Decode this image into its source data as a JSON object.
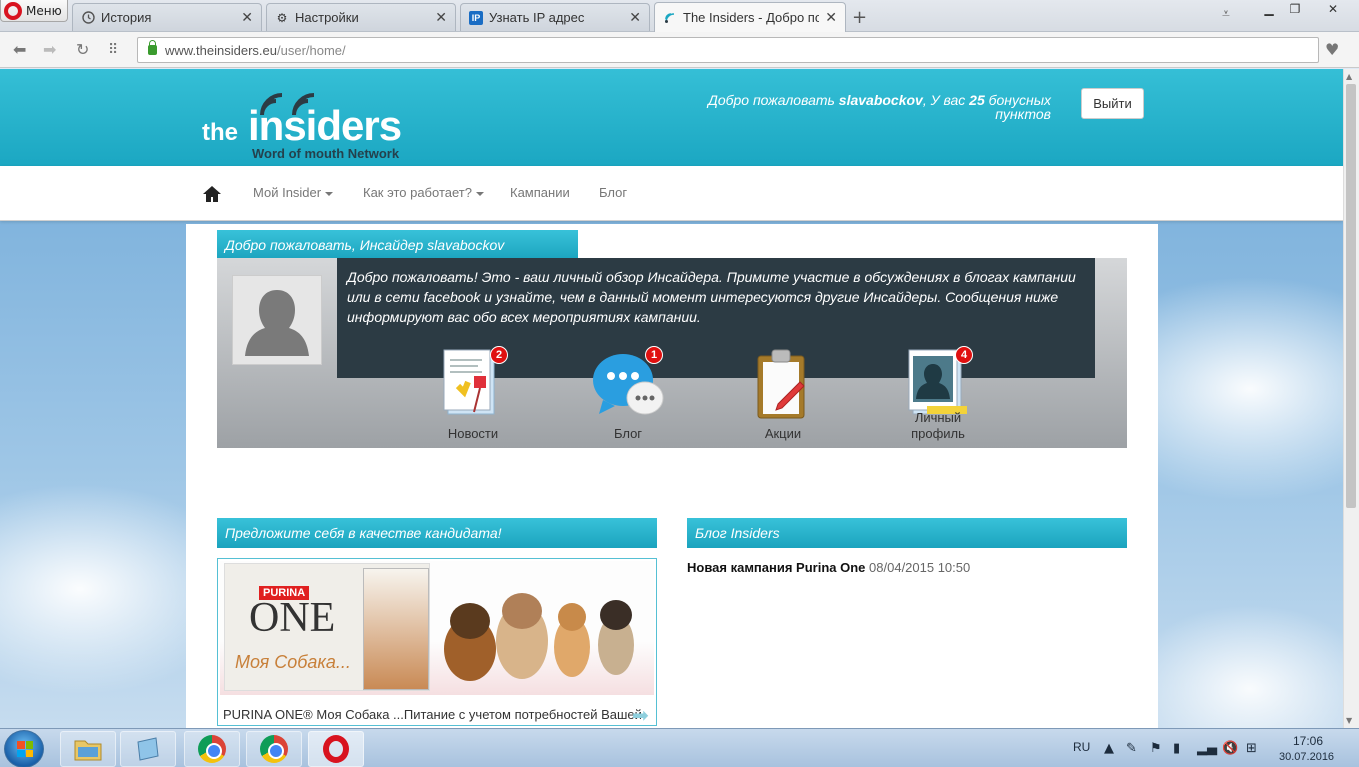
{
  "browser": {
    "menu_label": "Меню",
    "tabs": [
      {
        "label": "История",
        "icon": "clock-icon"
      },
      {
        "label": "Настройки",
        "icon": "gear-icon"
      },
      {
        "label": "Узнать IP адрес",
        "icon": "ip-icon"
      },
      {
        "label": "The Insiders - Добро пожаловать",
        "icon": "insiders-favicon",
        "active": true
      }
    ],
    "url_domain": "www.theinsiders.eu",
    "url_path": "/user/home/"
  },
  "header": {
    "logo_the": "the",
    "logo_insiders": "insiders",
    "logo_sub": "Word of mouth Network",
    "welcome_prefix": "Добро пожаловать ",
    "username": "slavabockov",
    "welcome_mid": ", У вас ",
    "points": "25",
    "welcome_suffix": " бонусных пунктов",
    "logout_label": "Выйти"
  },
  "nav": {
    "items": [
      {
        "label": "Мой Insider",
        "dropdown": true
      },
      {
        "label": "Как это работает?",
        "dropdown": true
      },
      {
        "label": "Кампании",
        "dropdown": false
      },
      {
        "label": "Блог",
        "dropdown": false
      }
    ]
  },
  "dashboard": {
    "title": "Добро пожаловать, Инсайдер slavabockov",
    "intro": "Добро пожаловать! Это - ваш личный обзор Инсайдера. Примите участие в обсуждениях в блогах кампании или в сети facebook и узнайте, чем в данный момент интересуются другие Инсайдеры. Сообщения ниже информируют вас обо всех мероприятиях кампании.",
    "items": [
      {
        "label": "Новости",
        "badge": "2",
        "icon": "news-icon"
      },
      {
        "label": "Блог",
        "badge": "1",
        "icon": "chat-bubbles-icon"
      },
      {
        "label": "Акции",
        "badge": "",
        "icon": "clipboard-icon"
      },
      {
        "label": "Личный профиль",
        "badge": "4",
        "icon": "profile-icon"
      }
    ]
  },
  "candidate": {
    "title": "Предложите себя в качестве кандидата!",
    "brand": "PURINA",
    "product": "ONE",
    "product_sub": "Моя Собака...",
    "caption": "PURINA ONE® Моя Собака ...Питание с учетом потребностей Вашей"
  },
  "blog": {
    "title": "Блог Insiders",
    "entries": [
      {
        "title": "Новая кампания Purina One",
        "date": "08/04/2015 10:50"
      }
    ]
  },
  "taskbar": {
    "lang": "RU",
    "time": "17:06",
    "date": "30.07.2016"
  },
  "colors": {
    "header_teal": "#1ba7c2",
    "dark_box": "#2c3b44",
    "badge_red": "#e01010"
  }
}
